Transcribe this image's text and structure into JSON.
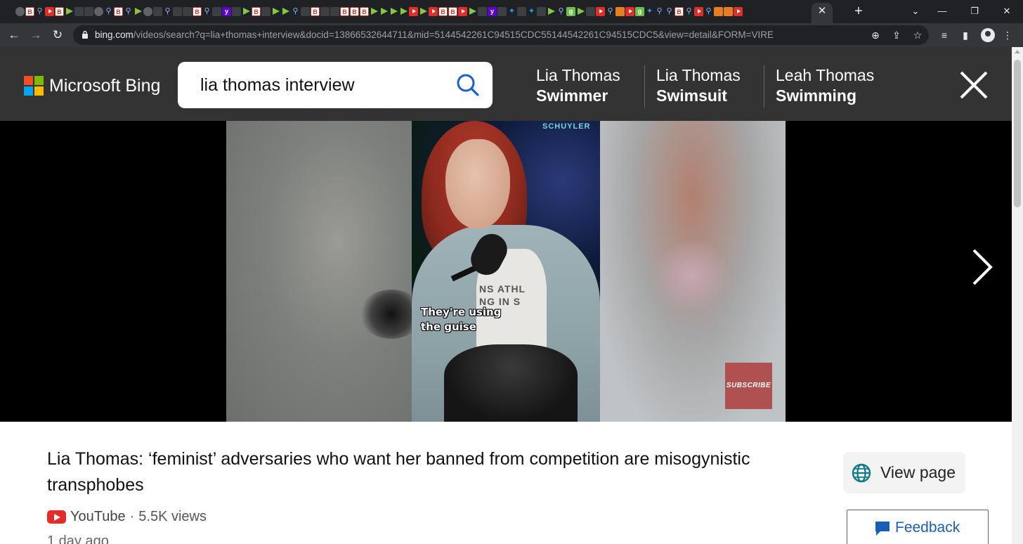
{
  "browser": {
    "url_host": "bing.com",
    "url_rest": "/videos/search?q=lia+thomas+interview&docid=13866532644711&mid=5144542261C94515CDC55144542261C94515CDC5&view=detail&FORM=VIRE",
    "tab_favicons": [
      "globe",
      "b",
      "search",
      "yt",
      "b",
      "rumble",
      "gray",
      "gray",
      "globe",
      "search",
      "b",
      "search",
      "rumble",
      "globe",
      "gray",
      "search",
      "gray",
      "gray",
      "b",
      "search",
      "gray",
      "yh",
      "gray",
      "rumble",
      "b",
      "gray",
      "rumble",
      "rumble",
      "search",
      "gray",
      "b",
      "gray",
      "gray",
      "b",
      "b",
      "b",
      "rumble",
      "rumble",
      "rumble",
      "rumble",
      "yt",
      "rumble",
      "yt",
      "b",
      "b",
      "yt",
      "rumble",
      "gray",
      "yh",
      "gray",
      "tw",
      "gray",
      "tw",
      "gray",
      "rumble",
      "search",
      "green",
      "rumble",
      "gray",
      "yt",
      "search",
      "orange",
      "yt",
      "green",
      "tw",
      "search",
      "search",
      "b",
      "search",
      "yt",
      "search",
      "orange",
      "orange",
      "yt"
    ]
  },
  "bing": {
    "brand": "Microsoft Bing",
    "search_query": "lia thomas interview",
    "related": [
      {
        "line1": "Lia Thomas",
        "line2": "Swimmer"
      },
      {
        "line1": "Lia Thomas",
        "line2": "Swimsuit"
      },
      {
        "line1": "Leah Thomas",
        "line2": "Swimming"
      }
    ],
    "logo_colors": [
      "#f25022",
      "#7fba00",
      "#00a4ef",
      "#ffb900"
    ]
  },
  "video": {
    "watermark": "SCHUYLER",
    "shirt_text_1": "NS ATHL",
    "shirt_text_2": "NG IN S",
    "caption_line1": "They're using",
    "caption_line2": "the guise",
    "subscribe": "SUBSCRIBE"
  },
  "result": {
    "title": "Lia Thomas: ‘feminist’ adversaries who want her banned from competition are misogynistic transphobes",
    "source": "YouTube",
    "separator": "·",
    "views": "5.5K views",
    "age": "1 day ago",
    "view_page_label": "View page",
    "feedback_label": "Feedback"
  }
}
